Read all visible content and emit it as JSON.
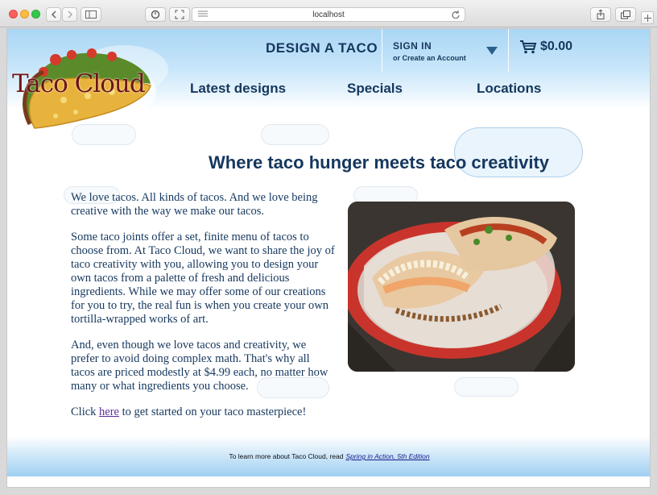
{
  "browser": {
    "url": "localhost"
  },
  "header": {
    "logo_text": "Taco Cloud",
    "design_link": "DESIGN A TACO",
    "signin_title": "SIGN IN",
    "signin_sub": "or Create an Account",
    "cart_total": "$0.00"
  },
  "nav": {
    "items": [
      {
        "label": "Latest designs"
      },
      {
        "label": "Specials"
      },
      {
        "label": "Locations"
      }
    ]
  },
  "main": {
    "headline": "Where taco hunger meets taco creativity",
    "paragraphs": [
      "We love tacos. All kinds of tacos. And we love being creative with the way we make our tacos.",
      "Some taco joints offer a set, finite menu of tacos to choose from. At Taco Cloud, we want to share the joy of taco creativity with you, allowing you to design your own tacos from a palette of fresh and delicious ingredients. While we may offer some of our creations for you to try, the real fun is when you create your own tortilla-wrapped works of art.",
      "And, even though we love tacos and creativity, we prefer to avoid doing complex math. That's why all tacos are priced modestly at $4.99 each, no matter how many or what ingredients you choose."
    ],
    "cta_prefix": "Click",
    "cta_link": "here",
    "cta_suffix": "to get started on your taco masterpiece!"
  },
  "footer": {
    "text": "To learn more about Taco Cloud, read",
    "link": "Spring in Action, 5th Edition"
  },
  "colors": {
    "brand_navy": "#15375e",
    "header_sky": "#a9d6f5",
    "link_purple": "#5b2ea0"
  }
}
